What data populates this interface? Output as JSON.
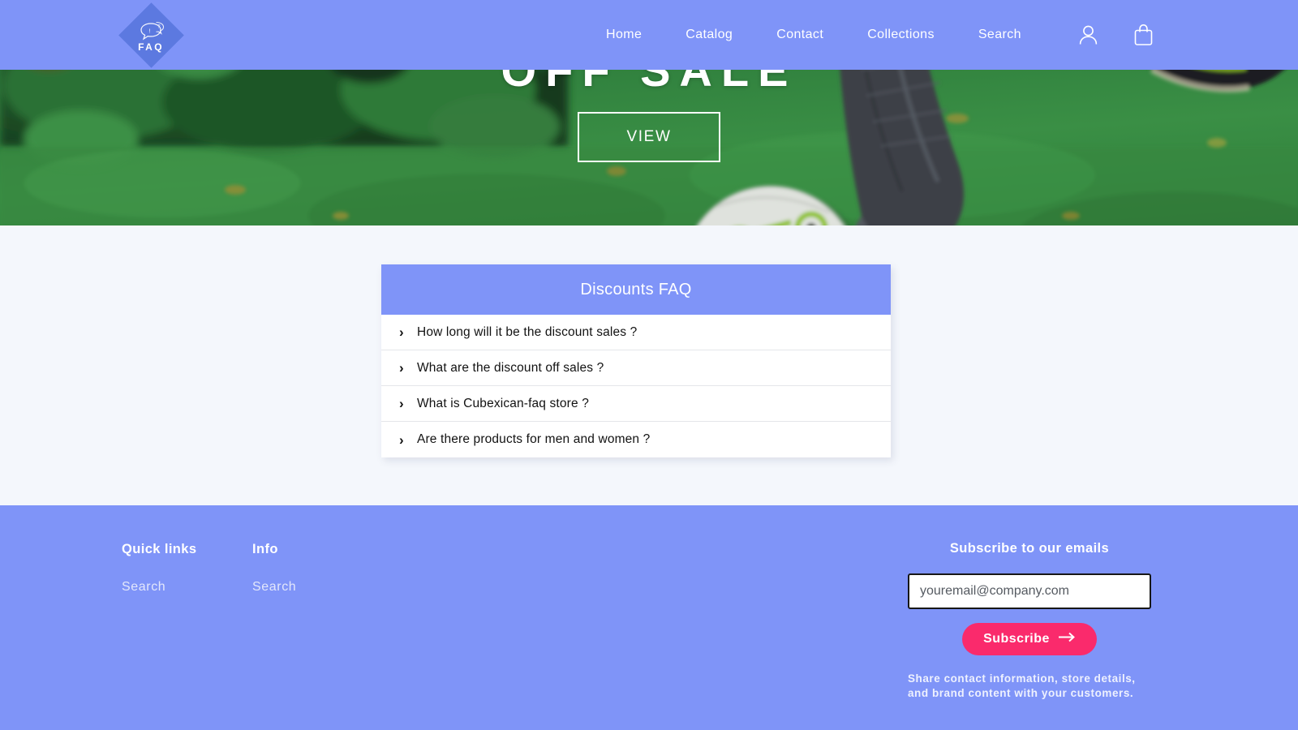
{
  "colors": {
    "brand_blue": "#7f94f8",
    "logo_diamond": "#5c79e0",
    "page_background": "#f4f7fc",
    "accent_pink": "#fa2a6c",
    "text_dark": "#121212",
    "white": "#ffffff"
  },
  "header": {
    "logo": {
      "text": "FAQ",
      "icon": "speech-bubbles-question-icon"
    },
    "nav": [
      {
        "label": "Home"
      },
      {
        "label": "Catalog"
      },
      {
        "label": "Contact"
      },
      {
        "label": "Collections"
      },
      {
        "label": "Search"
      }
    ],
    "icons": [
      {
        "name": "account-icon",
        "title": "Account"
      },
      {
        "name": "cart-icon",
        "title": "Cart"
      }
    ]
  },
  "hero": {
    "title": "OFF SALE",
    "button_label": "VIEW",
    "image_description": "person kicking a soccer ball on green grass"
  },
  "faq": {
    "title": "Discounts FAQ",
    "chevron": "›",
    "questions": [
      {
        "text": "How long will it be the discount sales ?"
      },
      {
        "text": "What are the discount off sales ?"
      },
      {
        "text": "What is Cubexican-faq store ?"
      },
      {
        "text": "Are there products for men and women ?"
      }
    ]
  },
  "footer": {
    "quick_links": {
      "title": "Quick links",
      "links": [
        {
          "label": "Search"
        }
      ]
    },
    "info": {
      "title": "Info",
      "links": [
        {
          "label": "Search"
        }
      ]
    },
    "subscribe": {
      "title": "Subscribe to our emails",
      "email_value": "youremail@company.com",
      "email_placeholder": "youremail@company.com",
      "button_label": "Subscribe",
      "button_icon": "arrow-right-icon",
      "note": "Share contact information, store details, and brand content with your customers."
    }
  }
}
